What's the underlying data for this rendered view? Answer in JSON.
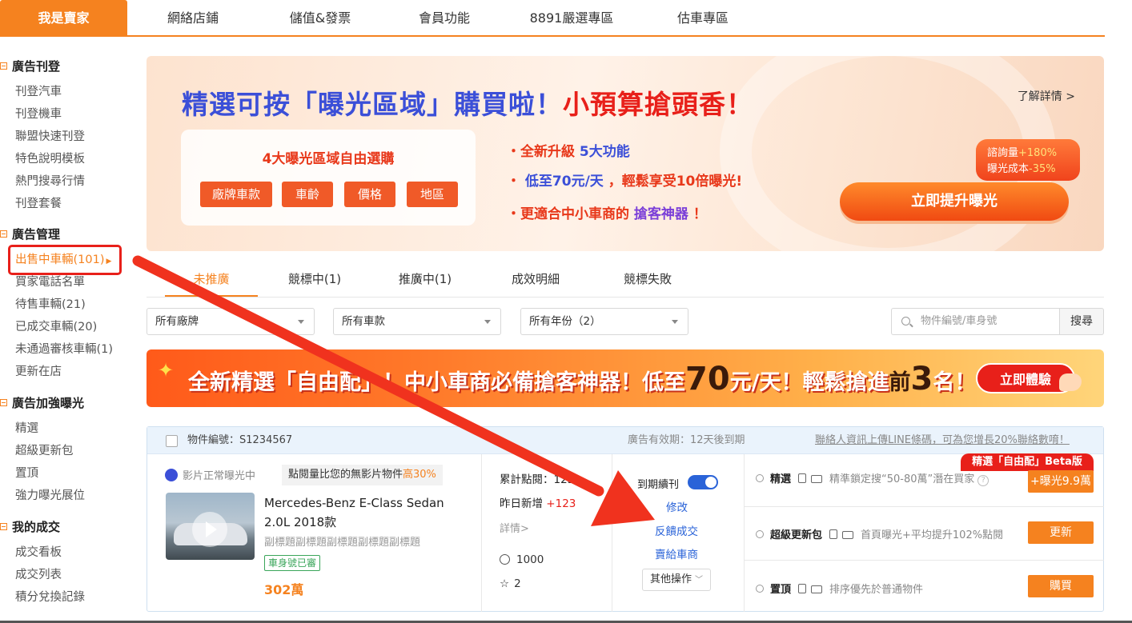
{
  "nav": {
    "items": [
      "我是賣家",
      "網絡店鋪",
      "儲值&發票",
      "會員功能",
      "8891嚴選專區",
      "估車專區"
    ]
  },
  "sidebar": {
    "sections": [
      {
        "title": "廣告刊登",
        "items": [
          "刊登汽車",
          "刊登機車",
          "聯盟快速刊登",
          "特色說明模板",
          "熱門搜尋行情",
          "刊登套餐"
        ]
      },
      {
        "title": "廣告管理",
        "items": [
          "出售中車輛(101)",
          "買家電話名單",
          "待售車輛(21)",
          "已成交車輛(20)",
          "未通過審核車輛(1)",
          "更新在店"
        ]
      },
      {
        "title": "廣告加強曝光",
        "items": [
          "精選",
          "超級更新包",
          "置頂",
          "強力曝光展位"
        ]
      },
      {
        "title": "我的成交",
        "items": [
          "成交看板",
          "成交列表",
          "積分兌換記錄"
        ]
      }
    ]
  },
  "banner": {
    "title_blue": "精選可按「曝光區域」購買啦！",
    "title_red": "小預算搶頭香！",
    "more": "了解詳情 >",
    "card_title": "4大曝光區域自由選購",
    "chips": [
      "廠牌車款",
      "車齡",
      "價格",
      "地區"
    ],
    "points": [
      {
        "a": "・全新升級 ",
        "b": "5大功能",
        "c": ""
      },
      {
        "a": "・ ",
        "b": "低至70元/天",
        "c": " ，輕鬆享受10倍曝光!"
      },
      {
        "a": "・更適合中小車商的 ",
        "b": "搶客神器",
        "c": " ！"
      }
    ],
    "badge_line1_a": "諮詢量",
    "badge_line1_b": "+180%",
    "badge_line2_a": "曝光成本",
    "badge_line2_b": "-35%",
    "cta": "立即提升曝光"
  },
  "tabs": [
    "未推廣",
    "競標中(1)",
    "推廣中(1)",
    "成效明細",
    "競標失敗"
  ],
  "filters": {
    "brand": "所有廠牌",
    "model": "所有車款",
    "year": "所有年份（2）",
    "search_placeholder": "物件編號/車身號",
    "search_btn": "搜尋"
  },
  "promo": {
    "t1": "全新精選「自由配」",
    "t2": "！中小車商必備搶客神器！低至",
    "t3": "70",
    "t4": "元/天！輕鬆搶進",
    "t5": "前",
    "t6": "3",
    "t7": "名！",
    "btn": "立即體驗"
  },
  "listing": {
    "id_label": "物件編號：S1234567",
    "validity": "廣告有效期：12天後到期",
    "line_link": "聯絡人資訊上傳LINE條碼，可為您增長20%聯絡數唷！",
    "video_status": "影片正常曝光中",
    "hint_a": "點閱量比您的無影片物件",
    "hint_b": "高30%",
    "title_line1": "Mercedes-Benz E-Class Sedan",
    "title_line2": "2.0L 2018款",
    "subtitle": "副標題副標題副標題副標題副標題",
    "vin_tag": "車身號已審",
    "price": "302萬",
    "stats_total": "累計點閱：123",
    "stats_yesterday_a": "昨日新增",
    "stats_yesterday_b": "+123",
    "details": "詳情>",
    "play_count": "1000",
    "fav_count": "2",
    "auto_renew": "到期續刊",
    "actions": [
      "修改",
      "反饋成交",
      "賣給車商"
    ],
    "other_ops": "其他操作",
    "beta": "精選「自由配」Beta版",
    "services": [
      {
        "name": "精選",
        "desc": "精準鎖定搜“50-80萬”潛在買家",
        "btn": "+曝光9.9萬"
      },
      {
        "name": "超級更新包",
        "desc": "首頁曝光+平均提升102%點閱",
        "btn": "更新"
      },
      {
        "name": "置頂",
        "desc": "排序優先於普通物件",
        "btn": "購買"
      }
    ]
  },
  "colors": {
    "accent": "#f5821f",
    "red": "#e8201a",
    "blue": "#2a63d8"
  }
}
